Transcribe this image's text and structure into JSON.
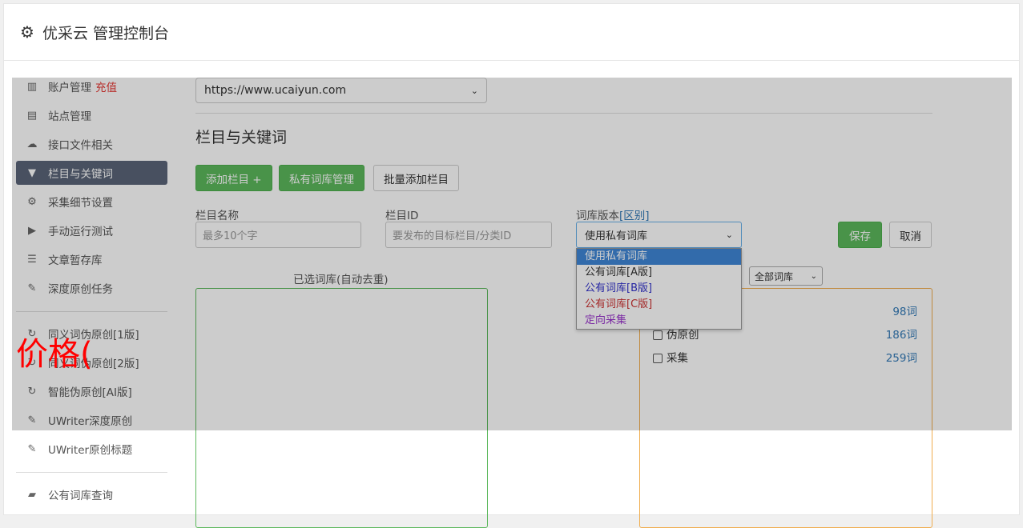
{
  "header": {
    "title": "优采云 管理控制台",
    "icon": "gear-icon"
  },
  "sidebar": {
    "items": [
      {
        "label": "账户管理",
        "extra": "充值",
        "icon": "bar-chart-icon"
      },
      {
        "label": "站点管理",
        "icon": "server-icon"
      },
      {
        "label": "接口文件相关",
        "icon": "cloud-upload-icon"
      },
      {
        "label": "栏目与关键词",
        "icon": "filter-icon",
        "active": true
      },
      {
        "label": "采集细节设置",
        "icon": "cogs-icon"
      },
      {
        "label": "手动运行测试",
        "icon": "play-circle-icon"
      },
      {
        "label": "文章暂存库",
        "icon": "database-icon"
      },
      {
        "label": "深度原创任务",
        "icon": "edit-icon"
      },
      {
        "label": "同义词伪原创[1版]",
        "icon": "refresh-icon"
      },
      {
        "label": "同义词伪原创[2版]",
        "icon": "refresh-icon"
      },
      {
        "label": "智能伪原创[AI版]",
        "icon": "refresh-icon"
      },
      {
        "label": "UWriter深度原创",
        "icon": "edit-icon"
      },
      {
        "label": "UWriter原创标题",
        "icon": "edit-icon"
      },
      {
        "label": "公有词库查询",
        "icon": "book-icon"
      }
    ]
  },
  "main": {
    "site_select": "https://www.ucaiyun.com",
    "section_title": "栏目与关键词",
    "buttons": {
      "add_column": "添加栏目 +",
      "private_lib": "私有词库管理",
      "batch_add": "批量添加栏目"
    },
    "form": {
      "name_label": "栏目名称",
      "name_placeholder": "最多10个字",
      "id_label": "栏目ID",
      "id_placeholder": "要发布的目标栏目/分类ID",
      "lib_label": "词库版本",
      "lib_label_link": "[区别]",
      "lib_value": "使用私有词库",
      "lib_options": [
        {
          "label": "使用私有词库",
          "color": "#ffffff"
        },
        {
          "label": "公有词库[A版]",
          "color": "#333333"
        },
        {
          "label": "公有词库[B版]",
          "color": "#3333cc"
        },
        {
          "label": "公有词库[C版]",
          "color": "#cc3333"
        },
        {
          "label": "定向采集",
          "color": "#9933cc"
        }
      ],
      "save": "保存",
      "cancel": "取消"
    },
    "selected_title": "已选词库(自动去重)",
    "filter_select": "全部词库",
    "lib_rows": [
      {
        "label": "",
        "count": "98词"
      },
      {
        "label": "伪原创",
        "count": "186词"
      },
      {
        "label": "采集",
        "count": "259词"
      }
    ]
  },
  "overlay_text": "价格("
}
